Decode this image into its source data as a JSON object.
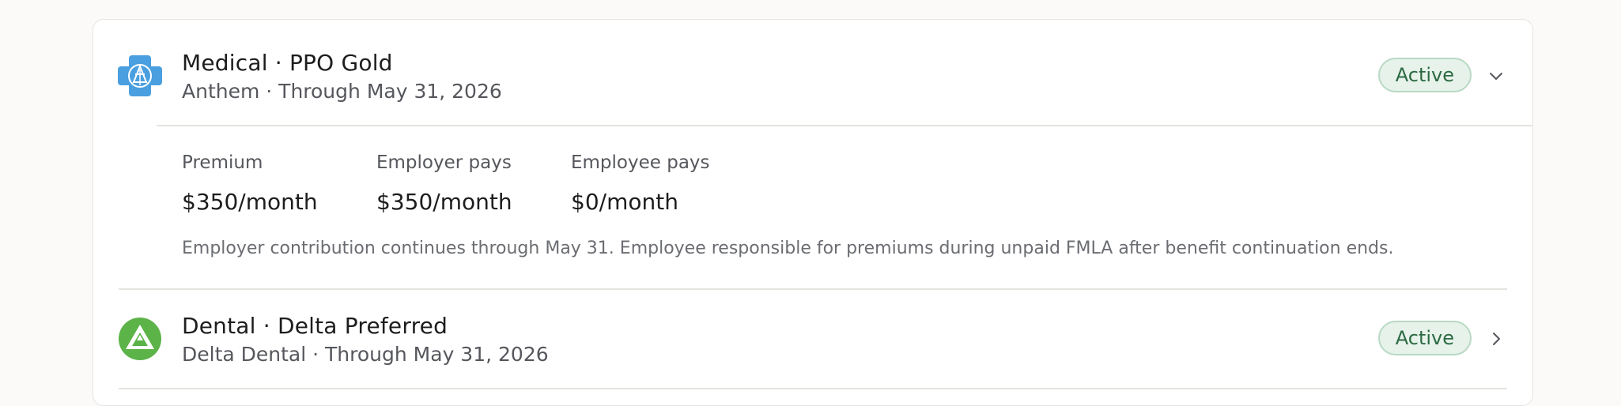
{
  "benefits": [
    {
      "title": "Medical · PPO Gold",
      "subtitle": "Anthem · Through May 31, 2026",
      "status": "Active",
      "expanded": true,
      "logo_icon": "anthem-cross-icon",
      "logo_color": "#4a9fe0",
      "details": {
        "premium_label": "Premium",
        "premium_value": "$350/month",
        "employer_label": "Employer pays",
        "employer_value": "$350/month",
        "employee_label": "Employee pays",
        "employee_value": "$0/month",
        "note": "Employer contribution continues through May 31. Employee responsible for premiums during unpaid FMLA after benefit continuation ends."
      }
    },
    {
      "title": "Dental · Delta Preferred",
      "subtitle": "Delta Dental · Through May 31, 2026",
      "status": "Active",
      "expanded": false,
      "logo_icon": "delta-dental-icon",
      "logo_color": "#5cb347"
    }
  ],
  "colors": {
    "badge_bg": "#e6f2ea",
    "badge_border": "#b9d9c4",
    "badge_text": "#2c6a43"
  }
}
